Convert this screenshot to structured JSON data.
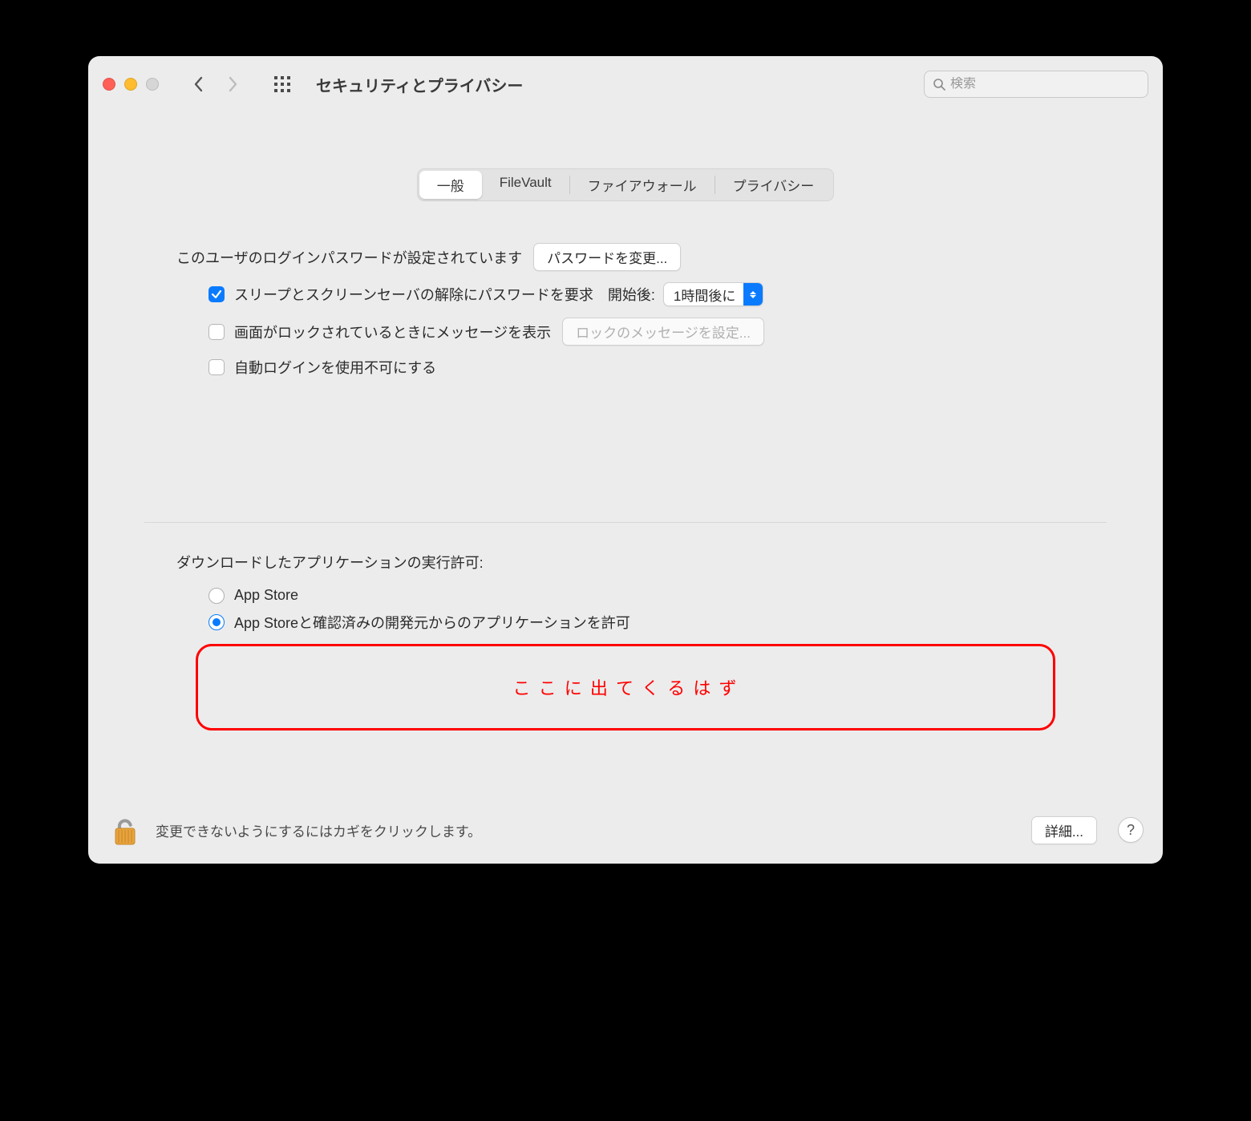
{
  "toolbar": {
    "title": "セキュリティとプライバシー",
    "search_placeholder": "検索"
  },
  "tabs": {
    "general": "一般",
    "filevault": "FileVault",
    "firewall": "ファイアウォール",
    "privacy": "プライバシー"
  },
  "general": {
    "login_pw_set": "このユーザのログインパスワードが設定されています",
    "change_password": "パスワードを変更...",
    "require_pw": "スリープとスクリーンセーバの解除にパスワードを要求",
    "after_label": "開始後:",
    "after_value": "1時間後に",
    "show_lock_msg": "画面がロックされているときにメッセージを表示",
    "set_lock_msg": "ロックのメッセージを設定...",
    "disable_autologin": "自動ログインを使用不可にする"
  },
  "downloads": {
    "title": "ダウンロードしたアプリケーションの実行許可:",
    "opt_appstore": "App Store",
    "opt_identified": "App Storeと確認済みの開発元からのアプリケーションを許可"
  },
  "annotation": "こ こ に 出 て く る は ず",
  "footer": {
    "lock_text": "変更できないようにするにはカギをクリックします。",
    "advanced": "詳細...",
    "help": "?"
  }
}
